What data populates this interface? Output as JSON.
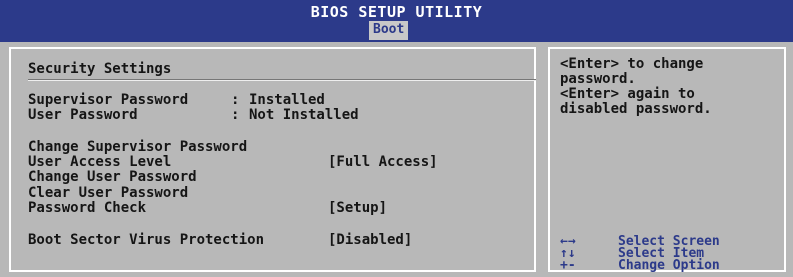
{
  "header": {
    "title": "BIOS SETUP UTILITY",
    "active_tab": "Boot"
  },
  "main": {
    "section_title": "Security Settings",
    "status": [
      {
        "label": "Supervisor Password",
        "sep": ":",
        "value": "Installed"
      },
      {
        "label": "User Password",
        "sep": ":",
        "value": "Not Installed"
      }
    ],
    "items": [
      {
        "label": "Change Supervisor Password",
        "value": ""
      },
      {
        "label": "User Access Level",
        "value": "[Full Access]"
      },
      {
        "label": "Change User Password",
        "value": ""
      },
      {
        "label": "Clear User Password",
        "value": ""
      },
      {
        "label": "Password Check",
        "value": "[Setup]"
      },
      {
        "label": "Boot Sector Virus Protection",
        "value": "[Disabled]"
      }
    ]
  },
  "help": {
    "text": "<Enter> to change\npassword.\n<Enter> again to\ndisabled password.",
    "keys": [
      {
        "key": "←→",
        "desc": "Select Screen"
      },
      {
        "key": "↑↓",
        "desc": "Select Item"
      },
      {
        "key": "+-",
        "desc": "Change Option"
      }
    ]
  },
  "colors": {
    "header_bg": "#2c3a8a",
    "panel_bg": "#b8b8b8",
    "text": "#151515",
    "key_text": "#2c3a8a"
  }
}
